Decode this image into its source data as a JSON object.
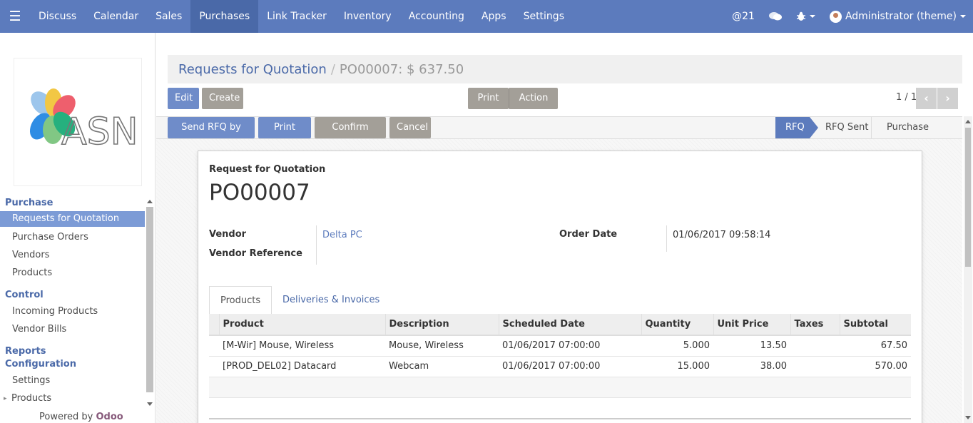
{
  "navbar": {
    "menu": [
      "Discuss",
      "Calendar",
      "Sales",
      "Purchases",
      "Link Tracker",
      "Inventory",
      "Accounting",
      "Apps",
      "Settings"
    ],
    "active": "Purchases",
    "mentions": "@21",
    "user": "Administrator (theme)",
    "color": "#5c7bbd"
  },
  "sidebar": {
    "logo_text": "ASN",
    "sections": [
      {
        "title": "Purchase",
        "items": [
          "Requests for Quotation",
          "Purchase Orders",
          "Vendors",
          "Products"
        ]
      },
      {
        "title": "Control",
        "items": [
          "Incoming Products",
          "Vendor Bills"
        ]
      },
      {
        "title": "Reports",
        "items": []
      },
      {
        "title": "Configuration",
        "items": [
          "Settings",
          "Products"
        ]
      }
    ],
    "active_item": "Requests for Quotation",
    "powered_by": "Powered by",
    "powered_brand": "Odoo"
  },
  "control_panel": {
    "breadcrumb_parent": "Requests for Quotation",
    "breadcrumb_separator": "/",
    "breadcrumb_current": "PO00007: $ 637.50",
    "edit_label": "Edit",
    "create_label": "Create",
    "print_label": "Print",
    "action_label": "Action",
    "pager": "1 / 1"
  },
  "statusbar": {
    "buttons": [
      "Send RFQ by Email",
      "Print RFQ",
      "Confirm Order",
      "Cancel"
    ],
    "stages": [
      "RFQ",
      "RFQ Sent",
      "Purchase Order"
    ],
    "active_stage": "RFQ"
  },
  "form": {
    "doc_label": "Request for Quotation",
    "doc_name": "PO00007",
    "vendor_label": "Vendor",
    "vendor_value": "Delta PC",
    "vendor_ref_label": "Vendor Reference",
    "order_date_label": "Order Date",
    "order_date_value": "01/06/2017 09:58:14",
    "tabs": [
      "Products",
      "Deliveries & Invoices"
    ],
    "active_tab": "Products",
    "columns": [
      "Product",
      "Description",
      "Scheduled Date",
      "Quantity",
      "Unit Price",
      "Taxes",
      "Subtotal"
    ],
    "lines": [
      {
        "product": "[M-Wir] Mouse, Wireless",
        "description": "Mouse, Wireless",
        "date": "01/06/2017 07:00:00",
        "qty": "5.000",
        "price": "13.50",
        "taxes": "",
        "subtotal": "67.50"
      },
      {
        "product": "[PROD_DEL02] Datacard",
        "description": "Webcam",
        "date": "01/06/2017 07:00:00",
        "qty": "15.000",
        "price": "38.00",
        "taxes": "",
        "subtotal": "570.00"
      }
    ]
  }
}
